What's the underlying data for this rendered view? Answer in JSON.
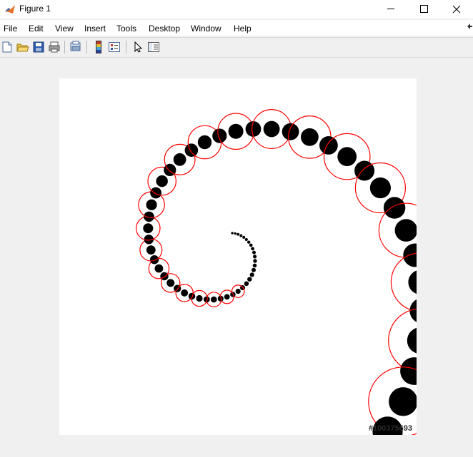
{
  "window": {
    "title": "Figure 1"
  },
  "menu": [
    "File",
    "Edit",
    "View",
    "Insert",
    "Tools",
    "Desktop",
    "Window",
    "Help"
  ],
  "toolbar": {
    "buttons": [
      "new-figure",
      "open-file",
      "save",
      "print",
      "print-preview",
      "colorbar",
      "legend",
      "select-arrow",
      "property-editor"
    ]
  },
  "figure": {
    "image_id_label": "#100375693",
    "colors": {
      "dots": "#000000",
      "circles": "#ff0000",
      "axes_background": "#ffffff",
      "window_background": "#f0f0f0"
    }
  }
}
